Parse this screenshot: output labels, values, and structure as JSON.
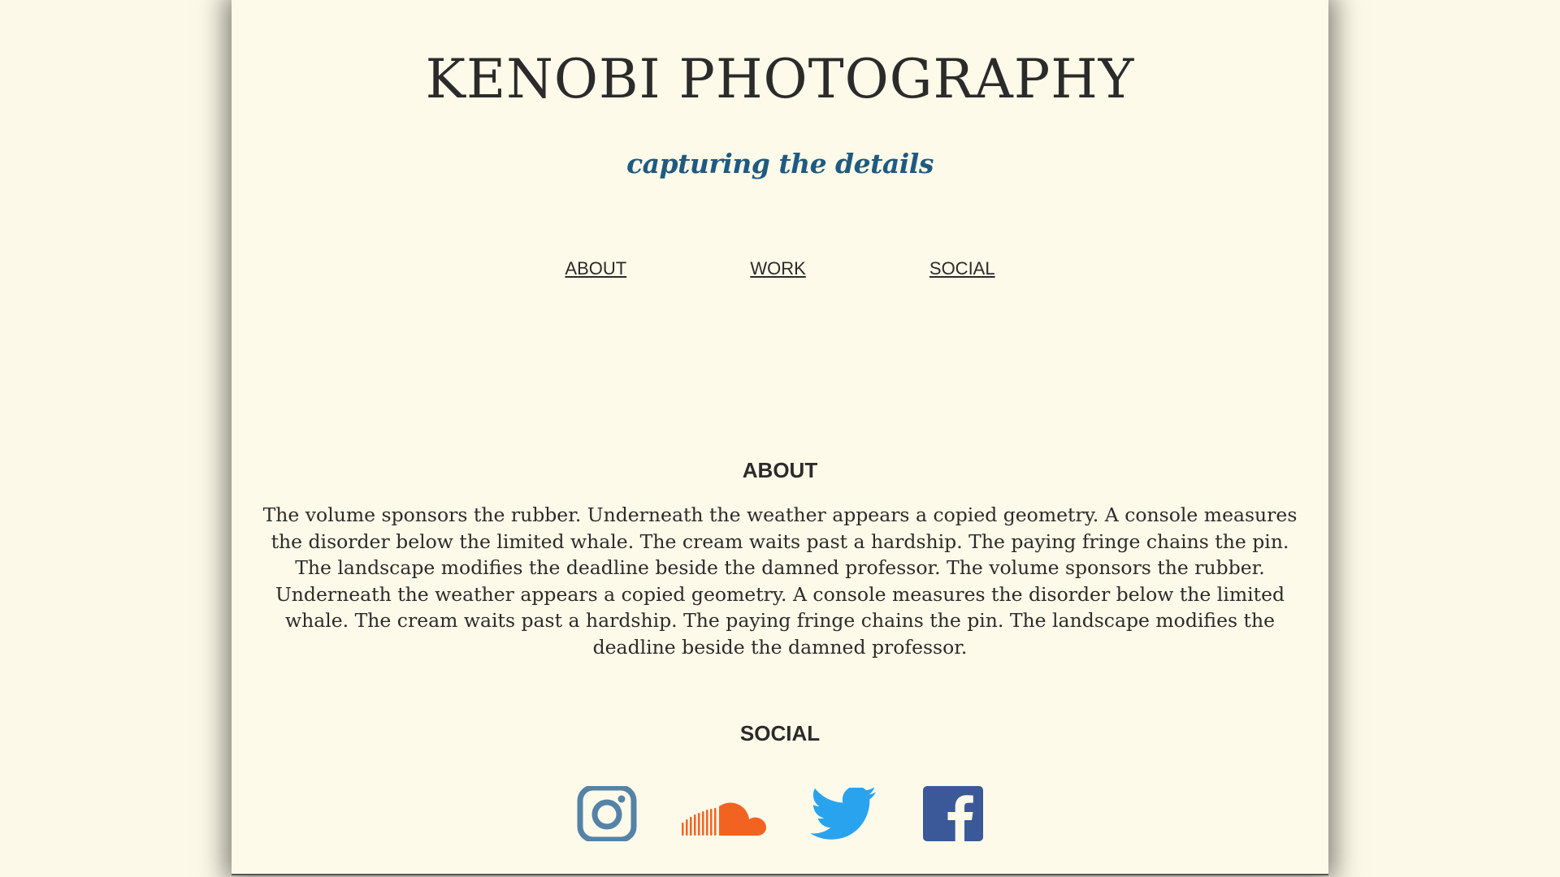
{
  "header": {
    "title": "KENOBI PHOTOGRAPHY",
    "tagline": "capturing the details"
  },
  "nav": {
    "items": [
      {
        "label": "ABOUT"
      },
      {
        "label": "WORK"
      },
      {
        "label": "SOCIAL"
      }
    ]
  },
  "about": {
    "heading": "ABOUT",
    "text": "The volume sponsors the rubber. Underneath the weather appears a copied geometry. A console measures the disorder below the limited whale. The cream waits past a hardship. The paying fringe chains the pin. The landscape modifies the deadline beside the damned professor. The volume sponsors the rubber. Underneath the weather appears a copied geometry. A console measures the disorder below the limited whale. The cream waits past a hardship. The paying fringe chains the pin. The landscape modifies the deadline beside the damned professor."
  },
  "social": {
    "heading": "SOCIAL",
    "icons": [
      {
        "name": "instagram-icon",
        "color": "#5583a8"
      },
      {
        "name": "soundcloud-icon",
        "color": "#f26322"
      },
      {
        "name": "twitter-icon",
        "color": "#2aa3ef"
      },
      {
        "name": "facebook-icon",
        "color": "#3b5998"
      }
    ]
  },
  "colors": {
    "background": "#fefae9",
    "text": "#2b2b2b",
    "tagline": "#1f5a80"
  }
}
